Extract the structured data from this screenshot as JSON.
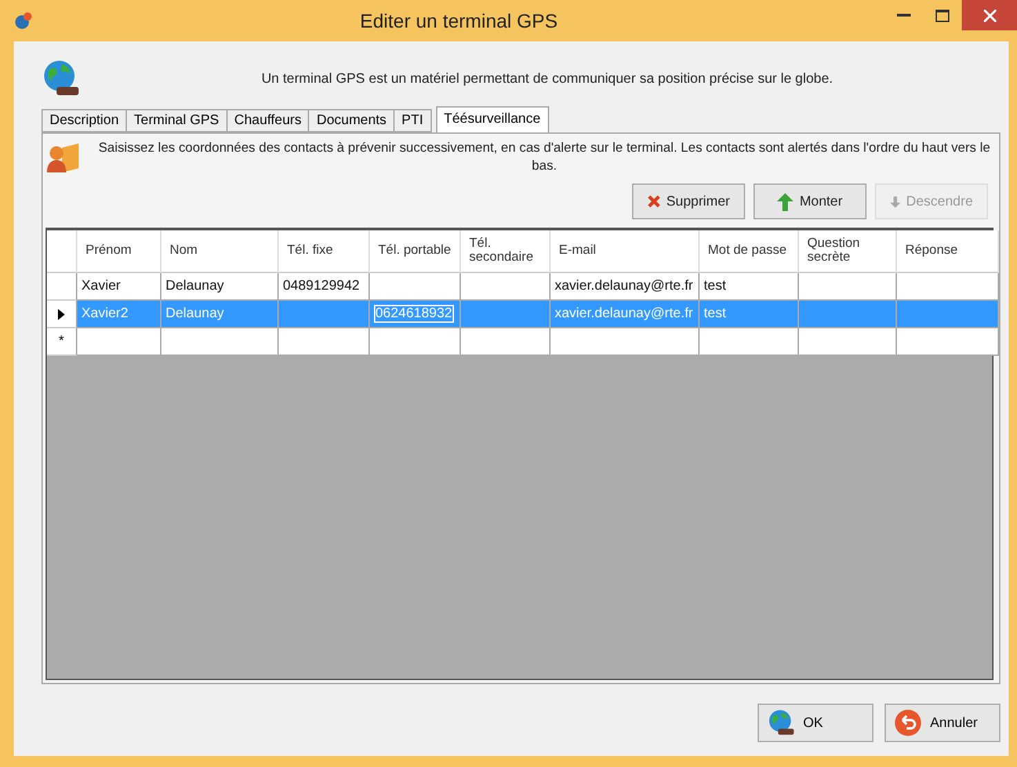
{
  "window": {
    "title": "Editer un terminal GPS"
  },
  "description": "Un terminal GPS est un matériel permettant de communiquer sa position précise sur le globe.",
  "tabs": [
    {
      "label": "Description",
      "selected": false
    },
    {
      "label": "Terminal GPS",
      "selected": false
    },
    {
      "label": "Chauffeurs",
      "selected": false
    },
    {
      "label": "Documents",
      "selected": false
    },
    {
      "label": "PTI",
      "selected": false
    },
    {
      "label": "Téésurveillance",
      "selected": true
    }
  ],
  "instructions": "Saisissez les coordonnées des contacts à prévenir successivement, en cas d'alerte sur le terminal. Les contacts sont alertés dans l'ordre du haut vers le bas.",
  "actions": [
    {
      "kind": "delete",
      "label": "Supprimer",
      "disabled": false
    },
    {
      "kind": "up",
      "label": "Monter",
      "disabled": false
    },
    {
      "kind": "down",
      "label": "Descendre",
      "disabled": true
    }
  ],
  "table": {
    "columns": [
      "Prénom",
      "Nom",
      "Tél. fixe",
      "Tél. portable",
      "Tél. secondaire",
      "E-mail",
      "Mot de passe",
      "Question secrète",
      "Réponse"
    ],
    "rows": [
      {
        "selected": false,
        "cells": [
          "Xavier",
          "Delaunay",
          "0489129942",
          null,
          null,
          "xavier.delaunay@rte.fr",
          "test",
          null,
          null
        ]
      },
      {
        "selected": true,
        "cells": [
          "Xavier2",
          "Delaunay",
          null,
          {
            "text": "0624618932",
            "editing": true
          },
          null,
          "xavier.delaunay@rte.fr",
          "test",
          null,
          null
        ]
      },
      {
        "selected": false,
        "new_row_marker": "*",
        "cells": [
          null,
          null,
          null,
          null,
          null,
          null,
          null,
          null,
          null
        ]
      }
    ]
  },
  "buttons": [
    {
      "kind": "ok",
      "label": "OK"
    },
    {
      "kind": "cancel",
      "label": "Annuler"
    }
  ]
}
